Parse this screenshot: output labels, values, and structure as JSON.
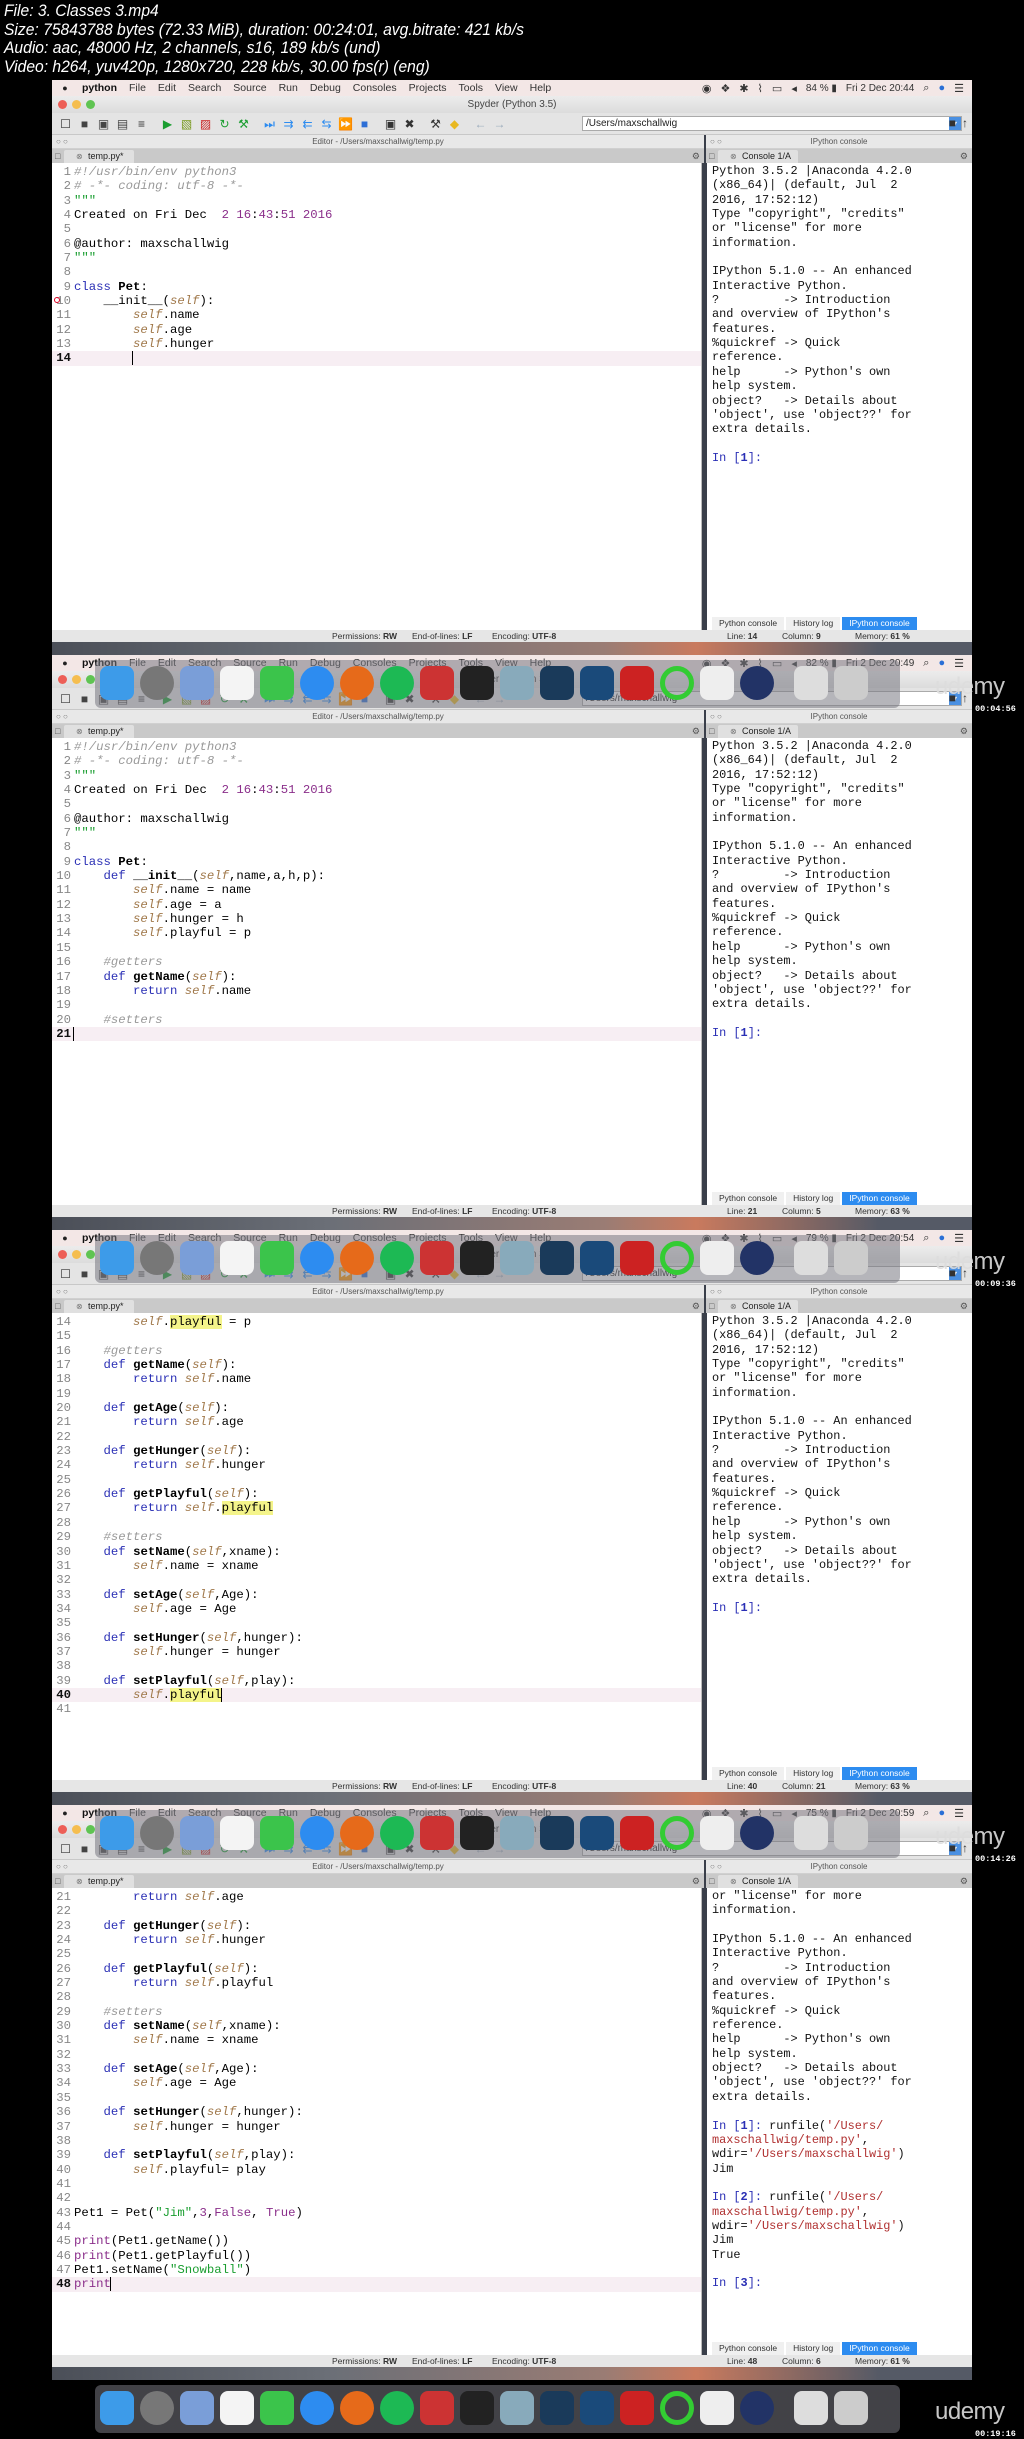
{
  "file_info": {
    "lines": [
      "File: 3. Classes 3.mp4",
      "Size: 75843788 bytes (72.33 MiB), duration: 00:24:01, avg.bitrate: 421 kb/s",
      "Audio: aac, 48000 Hz, 2 channels, s16, 189 kb/s (und)",
      "Video: h264, yuv420p, 1280x720, 228 kb/s, 30.00 fps(r) (eng)"
    ]
  },
  "common": {
    "menu": [
      "python",
      "File",
      "Edit",
      "Search",
      "Source",
      "Run",
      "Debug",
      "Consoles",
      "Projects",
      "Tools",
      "View",
      "Help"
    ],
    "window_title": "Spyder (Python 3.5)",
    "working_dir": "/Users/maxschallwig",
    "editor_header": "Editor - /Users/maxschallwig/temp.py",
    "console_header": "IPython console",
    "editor_tab": "temp.py*",
    "console_tab": "Console 1/A",
    "console_tabs": [
      "Python console",
      "History log",
      "IPython console"
    ],
    "status_labels": {
      "permissions": "Permissions:",
      "eol": "End-of-lines:",
      "encoding": "Encoding:",
      "line": "Line:",
      "column": "Column:",
      "memory": "Memory:"
    },
    "status_values": {
      "permissions": "RW",
      "eol": "LF",
      "encoding": "UTF-8"
    },
    "watermark": "udemy",
    "date": "Fri 2 Dec",
    "toolbar_icons": [
      "new-file-icon",
      "open-file-icon",
      "save-icon",
      "save-all-icon",
      "outline-icon",
      "run-icon",
      "run-cell-icon",
      "run-cell-advance-icon",
      "rerun-icon",
      "debug-icon",
      "step-icon",
      "indent-icon",
      "unindent-icon",
      "continue-icon",
      "fast-forward-icon",
      "stop-icon",
      "maximize-pane-icon",
      "fullscreen-icon",
      "preferences-icon",
      "python-path-icon",
      "back-icon",
      "forward-icon"
    ]
  },
  "frames": [
    {
      "battery": "84 %",
      "time": "20:44",
      "timestamp": "00:04:56",
      "status": {
        "line": "14",
        "column": "9",
        "memory": "61 %"
      },
      "first_line": 1,
      "current_line": 14,
      "breakpoint_line": 10,
      "code": [
        "#!/usr/bin/env python3",
        "# -*- coding: utf-8 -*-",
        "\"\"\"",
        "Created on Fri Dec  2 16:43:51 2016",
        "",
        "@author: maxschallwig",
        "\"\"\"",
        "",
        "class Pet:",
        "    __init__(self):",
        "        self.name",
        "        self.age",
        "        self.hunger",
        "        "
      ],
      "console": [
        "Python 3.5.2 |Anaconda 4.2.0",
        "(x86_64)| (default, Jul  2",
        "2016, 17:52:12)",
        "Type \"copyright\", \"credits\"",
        "or \"license\" for more",
        "information.",
        "",
        "IPython 5.1.0 -- An enhanced",
        "Interactive Python.",
        "?         -> Introduction",
        "and overview of IPython's",
        "features.",
        "%quickref -> Quick",
        "reference.",
        "help      -> Python's own",
        "help system.",
        "object?   -> Details about",
        "'object', use 'object??' for",
        "extra details.",
        "",
        "In [1]:"
      ]
    },
    {
      "battery": "82 %",
      "time": "20:49",
      "timestamp": "00:09:36",
      "status": {
        "line": "21",
        "column": "5",
        "memory": "63 %"
      },
      "first_line": 1,
      "current_line": 21,
      "breakpoint_line": null,
      "code": [
        "#!/usr/bin/env python3",
        "# -*- coding: utf-8 -*-",
        "\"\"\"",
        "Created on Fri Dec  2 16:43:51 2016",
        "",
        "@author: maxschallwig",
        "\"\"\"",
        "",
        "class Pet:",
        "    def __init__(self,name,a,h,p):",
        "        self.name = name",
        "        self.age = a",
        "        self.hunger = h",
        "        self.playful = p",
        "",
        "    #getters",
        "    def getName(self):",
        "        return self.name",
        "",
        "    #setters",
        ""
      ],
      "console": [
        "Python 3.5.2 |Anaconda 4.2.0",
        "(x86_64)| (default, Jul  2",
        "2016, 17:52:12)",
        "Type \"copyright\", \"credits\"",
        "or \"license\" for more",
        "information.",
        "",
        "IPython 5.1.0 -- An enhanced",
        "Interactive Python.",
        "?         -> Introduction",
        "and overview of IPython's",
        "features.",
        "%quickref -> Quick",
        "reference.",
        "help      -> Python's own",
        "help system.",
        "object?   -> Details about",
        "'object', use 'object??' for",
        "extra details.",
        "",
        "In [1]:"
      ]
    },
    {
      "battery": "79 %",
      "time": "20:54",
      "timestamp": "00:14:26",
      "status": {
        "line": "40",
        "column": "21",
        "memory": "63 %"
      },
      "first_line": 14,
      "current_line": 40,
      "breakpoint_line": null,
      "highlight_word": "playful",
      "code": [
        "        self.playful = p",
        "",
        "    #getters",
        "    def getName(self):",
        "        return self.name",
        "",
        "    def getAge(self):",
        "        return self.age",
        "",
        "    def getHunger(self):",
        "        return self.hunger",
        "",
        "    def getPlayful(self):",
        "        return self.playful",
        "",
        "    #setters",
        "    def setName(self,xname):",
        "        self.name = xname",
        "",
        "    def setAge(self,Age):",
        "        self.age = Age",
        "",
        "    def setHunger(self,hunger):",
        "        self.hunger = hunger",
        "",
        "    def setPlayful(self,play):",
        "        self.playful",
        ""
      ],
      "console": [
        "Python 3.5.2 |Anaconda 4.2.0",
        "(x86_64)| (default, Jul  2",
        "2016, 17:52:12)",
        "Type \"copyright\", \"credits\"",
        "or \"license\" for more",
        "information.",
        "",
        "IPython 5.1.0 -- An enhanced",
        "Interactive Python.",
        "?         -> Introduction",
        "and overview of IPython's",
        "features.",
        "%quickref -> Quick",
        "reference.",
        "help      -> Python's own",
        "help system.",
        "object?   -> Details about",
        "'object', use 'object??' for",
        "extra details.",
        "",
        "In [1]:"
      ]
    },
    {
      "battery": "75 %",
      "time": "20:59",
      "timestamp": "00:19:16",
      "status": {
        "line": "48",
        "column": "6",
        "memory": "61 %"
      },
      "first_line": 21,
      "current_line": 48,
      "breakpoint_line": null,
      "code": [
        "        return self.age",
        "",
        "    def getHunger(self):",
        "        return self.hunger",
        "",
        "    def getPlayful(self):",
        "        return self.playful",
        "",
        "    #setters",
        "    def setName(self,xname):",
        "        self.name = xname",
        "",
        "    def setAge(self,Age):",
        "        self.age = Age",
        "",
        "    def setHunger(self,hunger):",
        "        self.hunger = hunger",
        "",
        "    def setPlayful(self,play):",
        "        self.playful= play",
        "",
        "",
        "Pet1 = Pet(\"Jim\",3,False, True)",
        "",
        "print(Pet1.getName())",
        "print(Pet1.getPlayful())",
        "Pet1.setName(\"Snowball\")",
        "print"
      ],
      "console": [
        "or \"license\" for more",
        "information.",
        "",
        "IPython 5.1.0 -- An enhanced",
        "Interactive Python.",
        "?         -> Introduction",
        "and overview of IPython's",
        "features.",
        "%quickref -> Quick",
        "reference.",
        "help      -> Python's own",
        "help system.",
        "object?   -> Details about",
        "'object', use 'object??' for",
        "extra details.",
        "",
        "In [1]: runfile('/Users/",
        "maxschallwig/temp.py',",
        "wdir='/Users/maxschallwig')",
        "Jim",
        "",
        "In [2]: runfile('/Users/",
        "maxschallwig/temp.py',",
        "wdir='/Users/maxschallwig')",
        "Jim",
        "True",
        "",
        "In [3]:"
      ]
    }
  ]
}
